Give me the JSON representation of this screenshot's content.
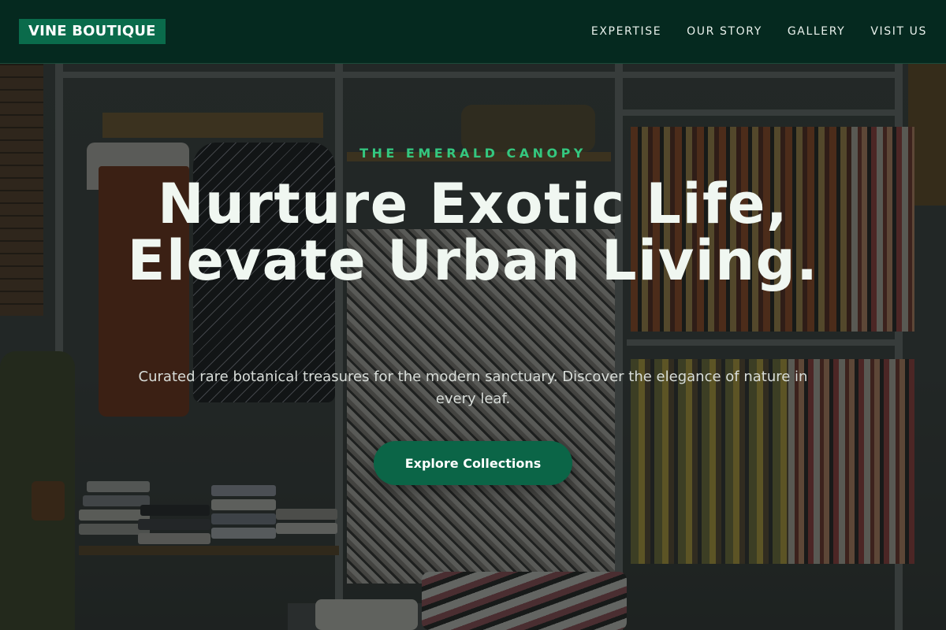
{
  "brand": {
    "logo_text": "VINE BOUTIQUE",
    "logo_bg": "#0a6b4b",
    "header_bg": "#05291f"
  },
  "nav": {
    "items": [
      {
        "label": "EXPERTISE"
      },
      {
        "label": "OUR STORY"
      },
      {
        "label": "GALLERY"
      },
      {
        "label": "VISIT US"
      }
    ]
  },
  "hero": {
    "eyebrow": "THE EMERALD CANOPY",
    "headline": "Nurture Exotic Life, Elevate Urban Living.",
    "subtext": "Curated rare botanical treasures for the modern sanctuary. Discover the elegance of nature in every leaf.",
    "cta_label": "Explore Collections",
    "accent_color": "#34c77f",
    "cta_color": "#0b6547"
  }
}
